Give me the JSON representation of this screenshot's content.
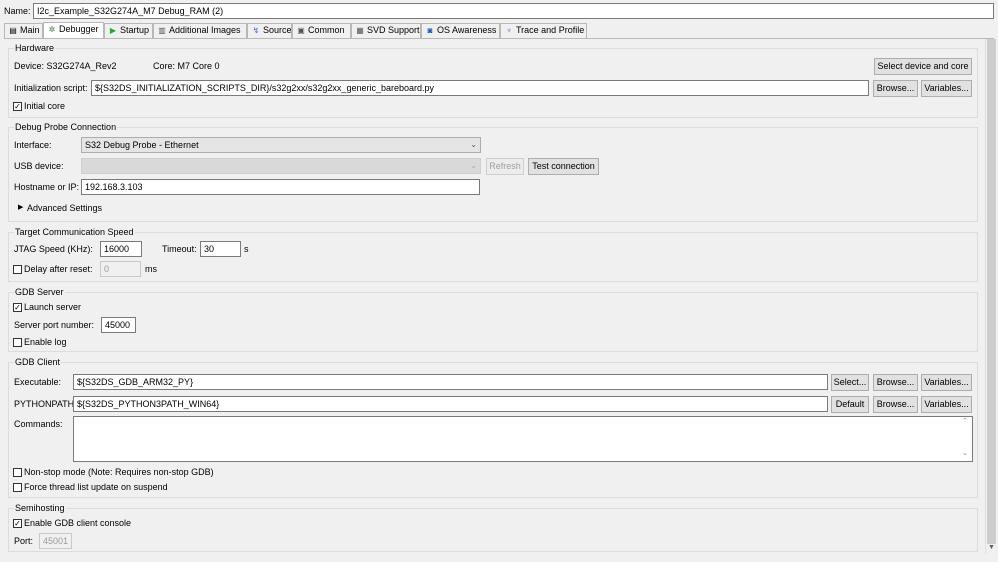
{
  "name_label": "Name:",
  "name_value": "I2c_Example_S32G274A_M7 Debug_RAM (2)",
  "tabs": [
    {
      "label": "Main",
      "icon": "main-icon"
    },
    {
      "label": "Debugger",
      "icon": "debugger-icon"
    },
    {
      "label": "Startup",
      "icon": "startup-icon"
    },
    {
      "label": "Additional Images",
      "icon": "images-icon"
    },
    {
      "label": "Source",
      "icon": "source-icon"
    },
    {
      "label": "Common",
      "icon": "common-icon"
    },
    {
      "label": "SVD Support",
      "icon": "svd-icon"
    },
    {
      "label": "OS Awareness",
      "icon": "os-icon"
    },
    {
      "label": "Trace and Profile",
      "icon": "trace-icon"
    }
  ],
  "hardware": {
    "title": "Hardware",
    "device": "Device: S32G274A_Rev2",
    "core": "Core: M7 Core 0",
    "select_btn": "Select device and core",
    "init_label": "Initialization script:",
    "init_value": "${S32DS_INITIALIZATION_SCRIPTS_DIR}/s32g2xx/s32g2xx_generic_bareboard.py",
    "browse": "Browse...",
    "variables": "Variables...",
    "initial_core": "Initial core",
    "initial_core_checked": true
  },
  "probe": {
    "title": "Debug Probe Connection",
    "interface_label": "Interface:",
    "interface_value": "S32 Debug Probe - Ethernet",
    "usb_label": "USB device:",
    "usb_value": "",
    "refresh": "Refresh",
    "test": "Test connection",
    "host_label": "Hostname or IP:",
    "host_value": "192.168.3.103",
    "advanced": "Advanced Settings"
  },
  "speed": {
    "title": "Target Communication Speed",
    "jtag_label": "JTAG Speed (KHz):",
    "jtag_value": "16000",
    "timeout_label": "Timeout:",
    "timeout_value": "30",
    "timeout_unit": "s",
    "delay_label": "Delay after reset:",
    "delay_checked": false,
    "delay_value": "0",
    "delay_unit": "ms"
  },
  "gdb_server": {
    "title": "GDB Server",
    "launch": "Launch server",
    "launch_checked": true,
    "port_label": "Server port number:",
    "port_value": "45000",
    "enable_log": "Enable log",
    "enable_log_checked": false
  },
  "gdb_client": {
    "title": "GDB Client",
    "exe_label": "Executable:",
    "exe_value": "${S32DS_GDB_ARM32_PY}",
    "select": "Select...",
    "browse": "Browse...",
    "variables": "Variables...",
    "py_label": "PYTHONPATH",
    "py_value": "${S32DS_PYTHON3PATH_WIN64}",
    "default": "Default",
    "commands_label": "Commands:",
    "commands_value": "",
    "nonstop": "Non-stop mode (Note: Requires non-stop GDB)",
    "nonstop_checked": false,
    "force": "Force thread list update on suspend",
    "force_checked": false
  },
  "semihosting": {
    "title": "Semihosting",
    "enable": "Enable GDB client console",
    "enable_checked": true,
    "port_label": "Port:",
    "port_value": "45001"
  }
}
